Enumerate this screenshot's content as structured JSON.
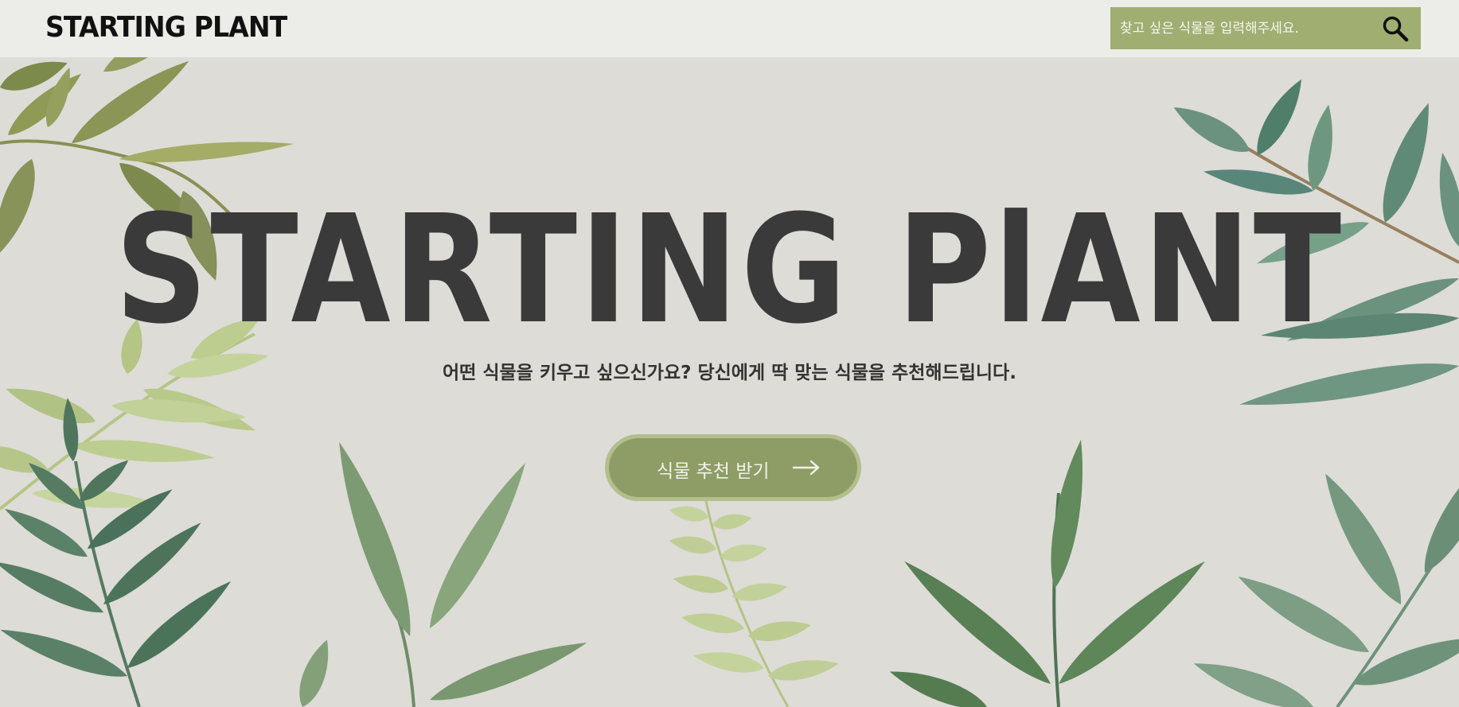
{
  "header": {
    "logo": "STARTING PLANT",
    "search": {
      "placeholder": "찾고 싶은 식물을 입력해주세요.",
      "value": "",
      "icon": "search-icon"
    }
  },
  "hero": {
    "title": "STARTING PlANT",
    "subtitle": "어떤 식물을 키우고 싶으신가요? 당신에게 딱 맞는 식물을 추천해드립니다.",
    "cta": {
      "label": "식물 추천 받기",
      "icon": "arrow-right-icon"
    }
  },
  "colors": {
    "background": "#dddcd7",
    "header_bg": "#ecede8",
    "search_bg": "#a0ae72",
    "cta_bg": "#8e9d65",
    "cta_border": "#b3bf8e",
    "title_text": "#3a3a3a",
    "leaf_dark": "#5f8466",
    "leaf_mid": "#7f9c74",
    "leaf_light": "#b7c98a"
  }
}
